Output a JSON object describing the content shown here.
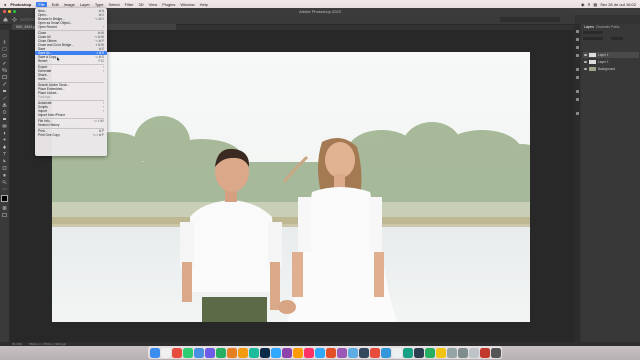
{
  "menubar": {
    "app_name": "Photoshop",
    "items": [
      "File",
      "Edit",
      "Image",
      "Layer",
      "Type",
      "Select",
      "Filter",
      "3D",
      "View",
      "Plugins",
      "Window",
      "Help"
    ],
    "active_item": "File",
    "clock": "Sex 28 de out 16:02"
  },
  "window": {
    "title": "Adobe Photoshop 2023"
  },
  "document_tab": {
    "label": "IMG_6543.jpg @ 33,3% (Layer 1, RGB/8)"
  },
  "file_menu": {
    "items": [
      {
        "label": "New...",
        "shortcut": "⌘N",
        "enabled": true
      },
      {
        "label": "Open...",
        "shortcut": "⌘O",
        "enabled": true
      },
      {
        "label": "Browse in Bridge...",
        "shortcut": "⌥⌘O",
        "enabled": true
      },
      {
        "label": "Open as Smart Object...",
        "shortcut": "",
        "enabled": true
      },
      {
        "label": "Open Recent",
        "shortcut": "›",
        "enabled": true
      },
      {
        "sep": true
      },
      {
        "label": "Close",
        "shortcut": "⌘W",
        "enabled": true
      },
      {
        "label": "Close All",
        "shortcut": "⌥⌘W",
        "enabled": true
      },
      {
        "label": "Close Others",
        "shortcut": "⌥⌘P",
        "enabled": true
      },
      {
        "label": "Close and Go to Bridge...",
        "shortcut": "⇧⌘W",
        "enabled": true
      },
      {
        "label": "Save",
        "shortcut": "⌘S",
        "enabled": true
      },
      {
        "label": "Save As...",
        "shortcut": "⇧⌘S",
        "enabled": true,
        "highlighted": true
      },
      {
        "label": "Save a Copy...",
        "shortcut": "⌥⌘S",
        "enabled": true
      },
      {
        "label": "Revert",
        "shortcut": "F12",
        "enabled": true
      },
      {
        "sep": true
      },
      {
        "label": "Export",
        "shortcut": "›",
        "enabled": true
      },
      {
        "label": "Generate",
        "shortcut": "›",
        "enabled": true
      },
      {
        "label": "Share...",
        "shortcut": "",
        "enabled": true
      },
      {
        "label": "Invite...",
        "shortcut": "",
        "enabled": true
      },
      {
        "sep": true
      },
      {
        "label": "Search Adobe Stock...",
        "shortcut": "",
        "enabled": true
      },
      {
        "label": "Place Embedded...",
        "shortcut": "",
        "enabled": true
      },
      {
        "label": "Place Linked...",
        "shortcut": "",
        "enabled": true
      },
      {
        "label": "Package...",
        "shortcut": "",
        "enabled": false
      },
      {
        "sep": true
      },
      {
        "label": "Automate",
        "shortcut": "›",
        "enabled": true
      },
      {
        "label": "Scripts",
        "shortcut": "›",
        "enabled": true
      },
      {
        "label": "Import",
        "shortcut": "›",
        "enabled": true
      },
      {
        "label": "Import from iPhone",
        "shortcut": "",
        "enabled": true
      },
      {
        "sep": true
      },
      {
        "label": "File Info...",
        "shortcut": "⌥⇧⌘I",
        "enabled": true
      },
      {
        "label": "Version History",
        "shortcut": "",
        "enabled": true
      },
      {
        "sep": true
      },
      {
        "label": "Print...",
        "shortcut": "⌘P",
        "enabled": true
      },
      {
        "label": "Print One Copy",
        "shortcut": "⌥⇧⌘P",
        "enabled": true
      }
    ]
  },
  "panels": {
    "tabs": [
      "Layers",
      "Channels",
      "Paths"
    ],
    "layers": [
      {
        "name": "Layer 1",
        "selected": true
      },
      {
        "name": "Layer 1",
        "selected": false
      },
      {
        "name": "Background",
        "selected": false
      }
    ]
  },
  "status_bar": {
    "zoom": "33,33%",
    "info": "5640 px x 3760 px (300 ppi)"
  },
  "dock_colors": [
    "#3b8ef0",
    "#f0f0f0",
    "#e74c3c",
    "#2ecc71",
    "#4a90e2",
    "#6c5ce7",
    "#27ae60",
    "#e67e22",
    "#f39c12",
    "#1abc9c",
    "#0b2a4a",
    "#31a8ff",
    "#8e44ad",
    "#ff9a00",
    "#ff3366",
    "#31a8ff",
    "#e34f26",
    "#9b59b6",
    "#5dade2",
    "#34495e",
    "#e74c3c",
    "#3498db",
    "#ecf0f1",
    "#16a085",
    "#2c3e50",
    "#27ae60",
    "#f1c40f",
    "#95a5a6",
    "#7f8c8d",
    "#bdc3c7",
    "#c0392b",
    "#555"
  ]
}
